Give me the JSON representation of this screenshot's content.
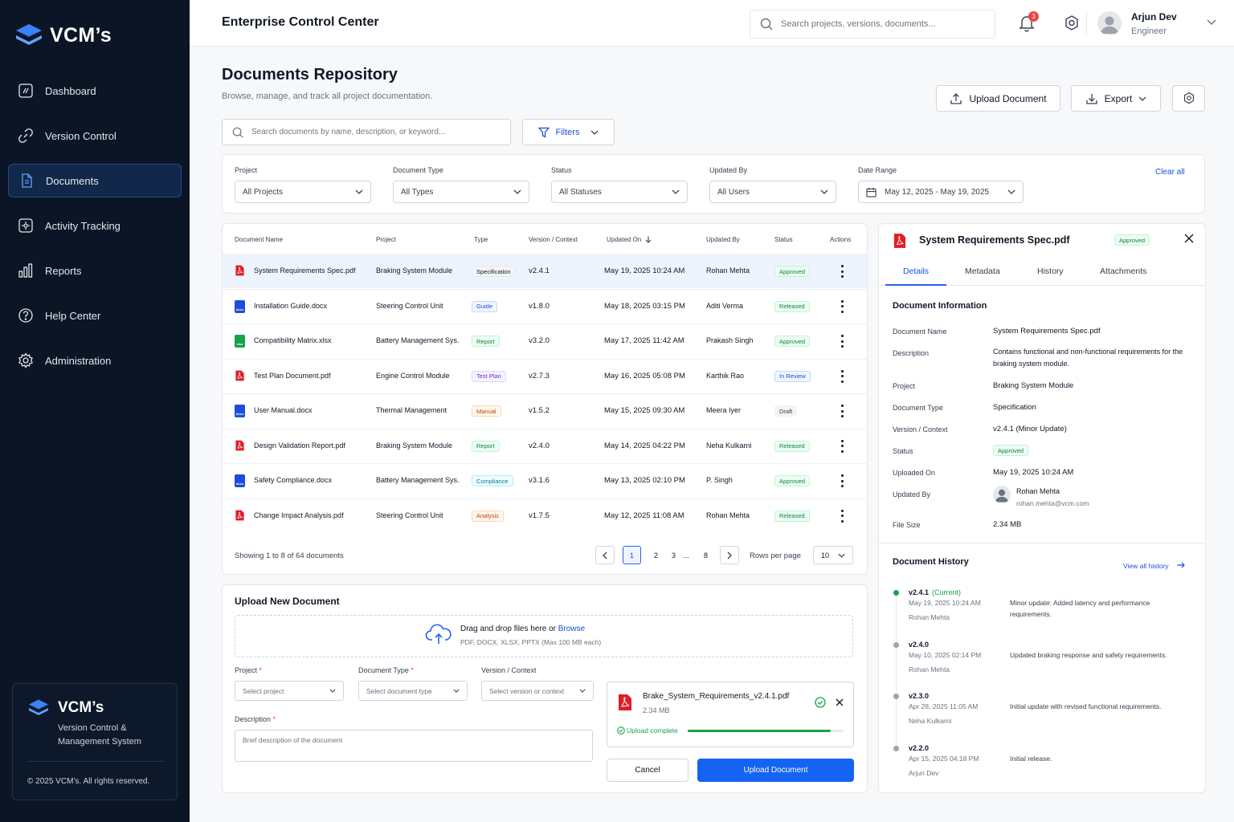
{
  "brand": {
    "name": "VCM’s",
    "subtitle": "Version Control & Management System",
    "copyright": "© 2025 VCM’s. All rights reserved."
  },
  "nav": [
    {
      "label": "Dashboard",
      "icon": "dashboard-icon"
    },
    {
      "label": "Version Control",
      "icon": "version-control-icon"
    },
    {
      "label": "Documents",
      "icon": "documents-icon",
      "active": true
    },
    {
      "label": "Activity Tracking",
      "icon": "activity-icon"
    },
    {
      "label": "Reports",
      "icon": "reports-icon"
    },
    {
      "label": "Help Center",
      "icon": "help-icon"
    },
    {
      "label": "Administration",
      "icon": "gear-icon"
    }
  ],
  "header": {
    "title": "Enterprise Control Center",
    "search_placeholder": "Search projects, versions, documents...",
    "notifications": "3",
    "user": {
      "name": "Arjun Dev",
      "role": "Engineer"
    }
  },
  "page": {
    "title": "Documents Repository",
    "subtitle": "Browse, manage, and track all project documentation.",
    "upload_label": "Upload Document",
    "export_label": "Export",
    "search_placeholder": "Search documents by name, description, or keyword...",
    "filters_label": "Filters"
  },
  "filters": {
    "project": {
      "label": "Project",
      "value": "All Projects"
    },
    "type": {
      "label": "Document Type",
      "value": "All Types"
    },
    "status": {
      "label": "Status",
      "value": "All Statuses"
    },
    "updated_by": {
      "label": "Updated By",
      "value": "All Users"
    },
    "date": {
      "label": "Date Range",
      "value": "May 12, 2025 - May 19, 2025"
    },
    "clear_label": "Clear all"
  },
  "table": {
    "headers": {
      "name": "Document Name",
      "project": "Project",
      "type": "Type",
      "version": "Version / Context",
      "updated_on": "Updated On",
      "updated_by": "Updated By",
      "status": "Status",
      "actions": "Actions"
    },
    "rows": [
      {
        "name": "System Requirements Spec.pdf",
        "ext": "pdf",
        "project": "Braking System Module",
        "type": "Specification",
        "version": "v2.4.1",
        "updated_on": "May 19, 2025 10:24 AM",
        "updated_by": "Rohan Mehta",
        "status": "Approved"
      },
      {
        "name": "Installation Guide.docx",
        "ext": "docx",
        "project": "Steering Control Unit",
        "type": "Guide",
        "version": "v1.8.0",
        "updated_on": "May 18, 2025 03:15 PM",
        "updated_by": "Aditi Verma",
        "status": "Released"
      },
      {
        "name": "Compatibility Matrix.xlsx",
        "ext": "xlsx",
        "project": "Battery Management Sys.",
        "type": "Report",
        "version": "v3.2.0",
        "updated_on": "May 17, 2025 11:42 AM",
        "updated_by": "Prakash Singh",
        "status": "Approved"
      },
      {
        "name": "Test Plan Document.pdf",
        "ext": "pdf",
        "project": "Engine Control Module",
        "type": "Test Plan",
        "version": "v2.7.3",
        "updated_on": "May 16, 2025 05:08 PM",
        "updated_by": "Karthik Rao",
        "status": "In Review"
      },
      {
        "name": "User Manual.docx",
        "ext": "docx",
        "project": "Thermal Management",
        "type": "Manual",
        "version": "v1.5.2",
        "updated_on": "May 15, 2025 09:30 AM",
        "updated_by": "Meera Iyer",
        "status": "Draft"
      },
      {
        "name": "Design Validation Report.pdf",
        "ext": "pdf",
        "project": "Braking System Module",
        "type": "Report",
        "version": "v2.4.0",
        "updated_on": "May 14, 2025 04:22 PM",
        "updated_by": "Neha Kulkarni",
        "status": "Released"
      },
      {
        "name": "Safety Compliance.docx",
        "ext": "docx",
        "project": "Battery Management Sys.",
        "type": "Compliance",
        "version": "v3.1.6",
        "updated_on": "May 13, 2025 02:10 PM",
        "updated_by": "P. Singh",
        "status": "Approved"
      },
      {
        "name": "Change Impact Analysis.pdf",
        "ext": "pdf",
        "project": "Steering Control Unit",
        "type": "Analysis",
        "version": "v1.7.5",
        "updated_on": "May 12, 2025 11:08 AM",
        "updated_by": "Rohan Mehta",
        "status": "Released"
      }
    ],
    "showing": "Showing 1 to 8 of 64 documents",
    "pages": [
      "1",
      "2",
      "3",
      "...",
      "8"
    ],
    "rows_per_page_label": "Rows per page",
    "rows_per_page": "10"
  },
  "upload": {
    "title": "Upload New Document",
    "drop_text": "Drag and drop files here or ",
    "browse": "Browse",
    "formats": "PDF, DOCX, XLSX, PPTX (Max 100 MB each)",
    "project_label": "Project",
    "project_placeholder": "Select project",
    "type_label": "Document Type",
    "type_placeholder": "Select document type",
    "version_label": "Version / Context",
    "version_placeholder": "Select version or context",
    "desc_label": "Description",
    "desc_placeholder": "Brief description of the document",
    "required_mark": "*",
    "file": {
      "name": "Brake_System_Requirements_v2.4.1.pdf",
      "size": "2.34 MB",
      "status": "Upload complete",
      "progress": 0.92
    },
    "cancel": "Cancel",
    "submit": "Upload Document"
  },
  "detail": {
    "title": "System Requirements Spec.pdf",
    "status": "Approved",
    "tabs": [
      "Details",
      "Metadata",
      "History",
      "Attachments"
    ],
    "info_title": "Document Information",
    "info": {
      "name": {
        "k": "Document Name",
        "v": "System Requirements Spec.pdf"
      },
      "description": {
        "k": "Description",
        "v": "Contains functional and non-functional requirements for the braking system module."
      },
      "project": {
        "k": "Project",
        "v": "Braking System Module"
      },
      "type": {
        "k": "Document Type",
        "v": "Specification"
      },
      "version": {
        "k": "Version / Context",
        "v": "v2.4.1 (Minor Update)"
      },
      "status": {
        "k": "Status",
        "v": "Approved"
      },
      "uploaded": {
        "k": "Uploaded On",
        "v": "May 19, 2025 10:24 AM"
      },
      "updated_by": {
        "k": "Updated By",
        "v": "Rohan Mehta",
        "email": "rohan.mehta@vcm.com"
      },
      "size": {
        "k": "File Size",
        "v": "2.34 MB"
      }
    },
    "history_title": "Document History",
    "history_link": "View all history",
    "history": [
      {
        "version": "v2.4.1",
        "tag": "(Current)",
        "date": "May 19, 2025 10:24 AM",
        "user": "Rohan Mehta",
        "desc": "Minor update: Added latency and performance requirements."
      },
      {
        "version": "v2.4.0",
        "tag": "",
        "date": "May 10, 2025 02:14 PM",
        "user": "Rohan Mehta",
        "desc": "Updated braking response and safety requirements."
      },
      {
        "version": "v2.3.0",
        "tag": "",
        "date": "Apr 28, 2025 11:05 AM",
        "user": "Neha Kulkarni",
        "desc": "Initial update with revised functional requirements."
      },
      {
        "version": "v2.2.0",
        "tag": "",
        "date": "Apr 15, 2025 04:18 PM",
        "user": "Arjun Dev",
        "desc": "Initial release."
      }
    ]
  },
  "colors": {
    "primary": "#1463f3",
    "sidebar": "#0b1526",
    "pdf": "#e11d2a",
    "docx": "#1d4ed8",
    "xlsx": "#16a34a"
  }
}
